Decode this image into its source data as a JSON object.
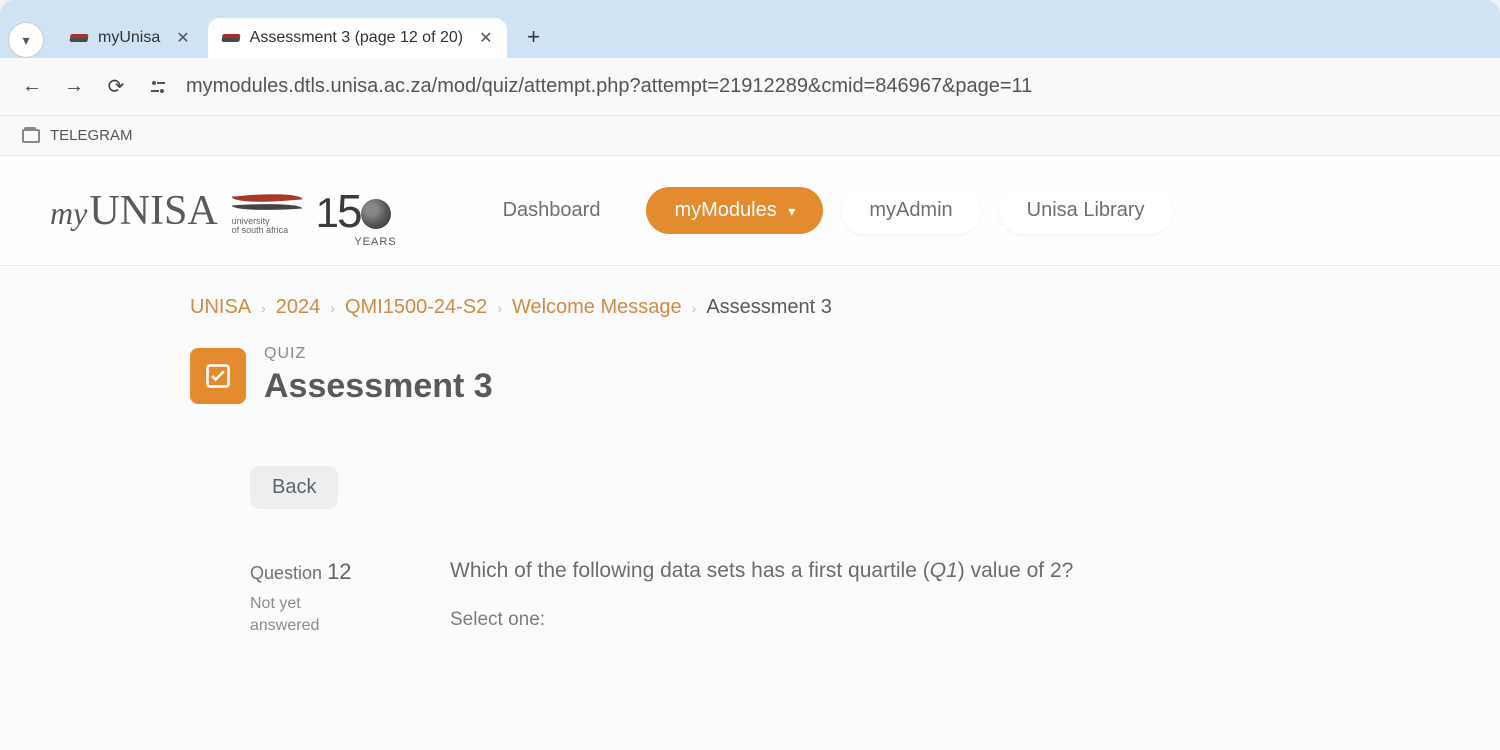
{
  "browser": {
    "tabs": [
      {
        "title": "myUnisa",
        "active": false
      },
      {
        "title": "Assessment 3 (page 12 of 20)",
        "active": true
      }
    ],
    "url": "mymodules.dtls.unisa.ac.za/mod/quiz/attempt.php?attempt=21912289&cmid=846967&page=11",
    "bookmarks": [
      "TELEGRAM"
    ]
  },
  "header": {
    "logo_prefix": "my",
    "logo_main": "UNISA",
    "logo_sub1": "university",
    "logo_sub2": "of south africa",
    "years_badge_num": "150",
    "years_badge_label": "YEARS",
    "nav": [
      {
        "label": "Dashboard",
        "active": false
      },
      {
        "label": "myModules",
        "active": true,
        "dropdown": true
      },
      {
        "label": "myAdmin",
        "active": false
      },
      {
        "label": "Unisa Library",
        "active": false
      }
    ]
  },
  "breadcrumbs": [
    "UNISA",
    "2024",
    "QMI1500-24-S2",
    "Welcome Message",
    "Assessment 3"
  ],
  "quiz": {
    "label": "QUIZ",
    "title": "Assessment 3",
    "back_label": "Back"
  },
  "question": {
    "number_label": "Question",
    "number": "12",
    "status_line1": "Not yet",
    "status_line2": "answered",
    "text_prefix": "Which of the following data sets has a first quartile (",
    "text_math": "Q1",
    "text_suffix": ") value of 2?",
    "select_label": "Select one:"
  }
}
